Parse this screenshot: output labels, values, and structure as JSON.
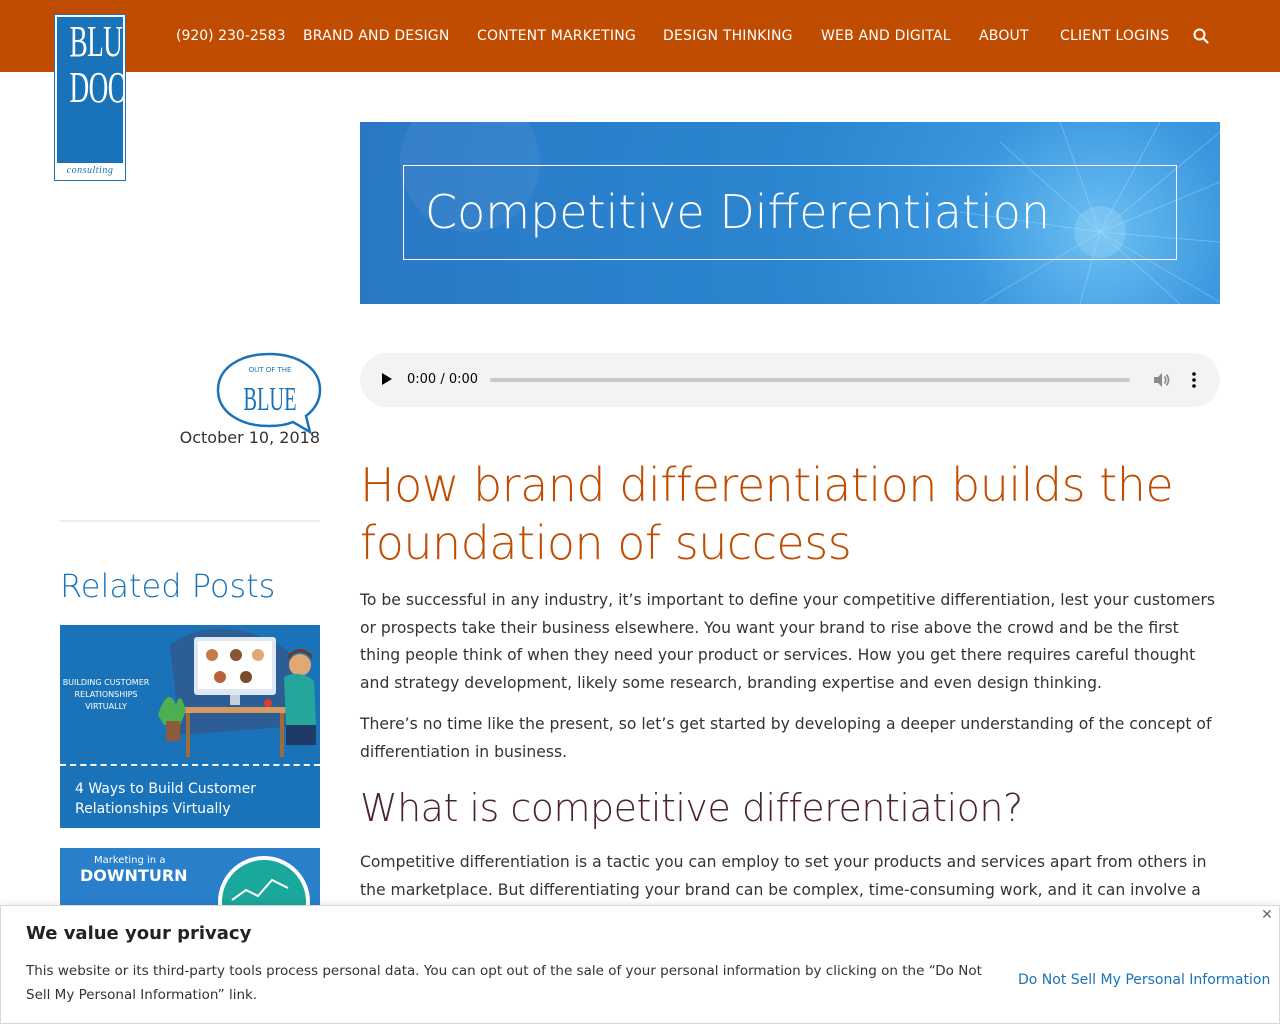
{
  "header": {
    "logo_words": [
      "BLUE",
      "DOOR",
      "consulting"
    ],
    "phone": "(920) 230-2583",
    "nav": [
      "BRAND AND DESIGN",
      "CONTENT MARKETING",
      "DESIGN THINKING",
      "WEB AND DIGITAL",
      "ABOUT",
      "CLIENT LOGINS"
    ],
    "search_icon": "search-icon"
  },
  "hero": {
    "title": "Competitive Differentiation"
  },
  "sidebar": {
    "badge_top": "OUT OF THE",
    "badge_word": "BLUE",
    "date": "October 10, 2018",
    "related_title": "Related Posts",
    "posts": [
      {
        "image_label": "BUILDING CUSTOMER RELATIONSHIPS VIRTUALLY",
        "caption": "4 Ways to Build Customer Relationships Virtually"
      },
      {
        "image_small": "Marketing in a",
        "image_big": "DOWNTURN"
      }
    ]
  },
  "audio": {
    "time": "0:00 / 0:00"
  },
  "article": {
    "heading": "How brand differentiation builds the foundation of success",
    "para1": "To be successful in any industry, it’s important to define your competitive differentiation, lest your customers or prospects take their business elsewhere. You want your brand to rise above the crowd and be the first thing people think of when they need your product or services. How you get there requires careful thought and strategy development, likely some research, branding expertise and even design thinking.",
    "para2": "There’s no time like the present, so let’s get started by developing a deeper understanding of the concept of differentiation in business.",
    "subheading": "What is competitive differentiation?",
    "para3": "Competitive differentiation is a tactic you can employ to set your products and services apart from others in the marketplace. But differentiating your brand can be complex, time-consuming work, and it can involve a good deal"
  },
  "privacy": {
    "title": "We value your privacy",
    "text": "This website or its third-party tools process personal data. You can opt out of the sale of your personal information by clicking on the “Do Not Sell My Personal Information” link.",
    "link": "Do Not Sell My Personal Information",
    "close": "✕"
  },
  "colors": {
    "brand_orange": "#bf4c00",
    "brand_blue": "#1a73b8",
    "subheading": "#4a2230"
  }
}
